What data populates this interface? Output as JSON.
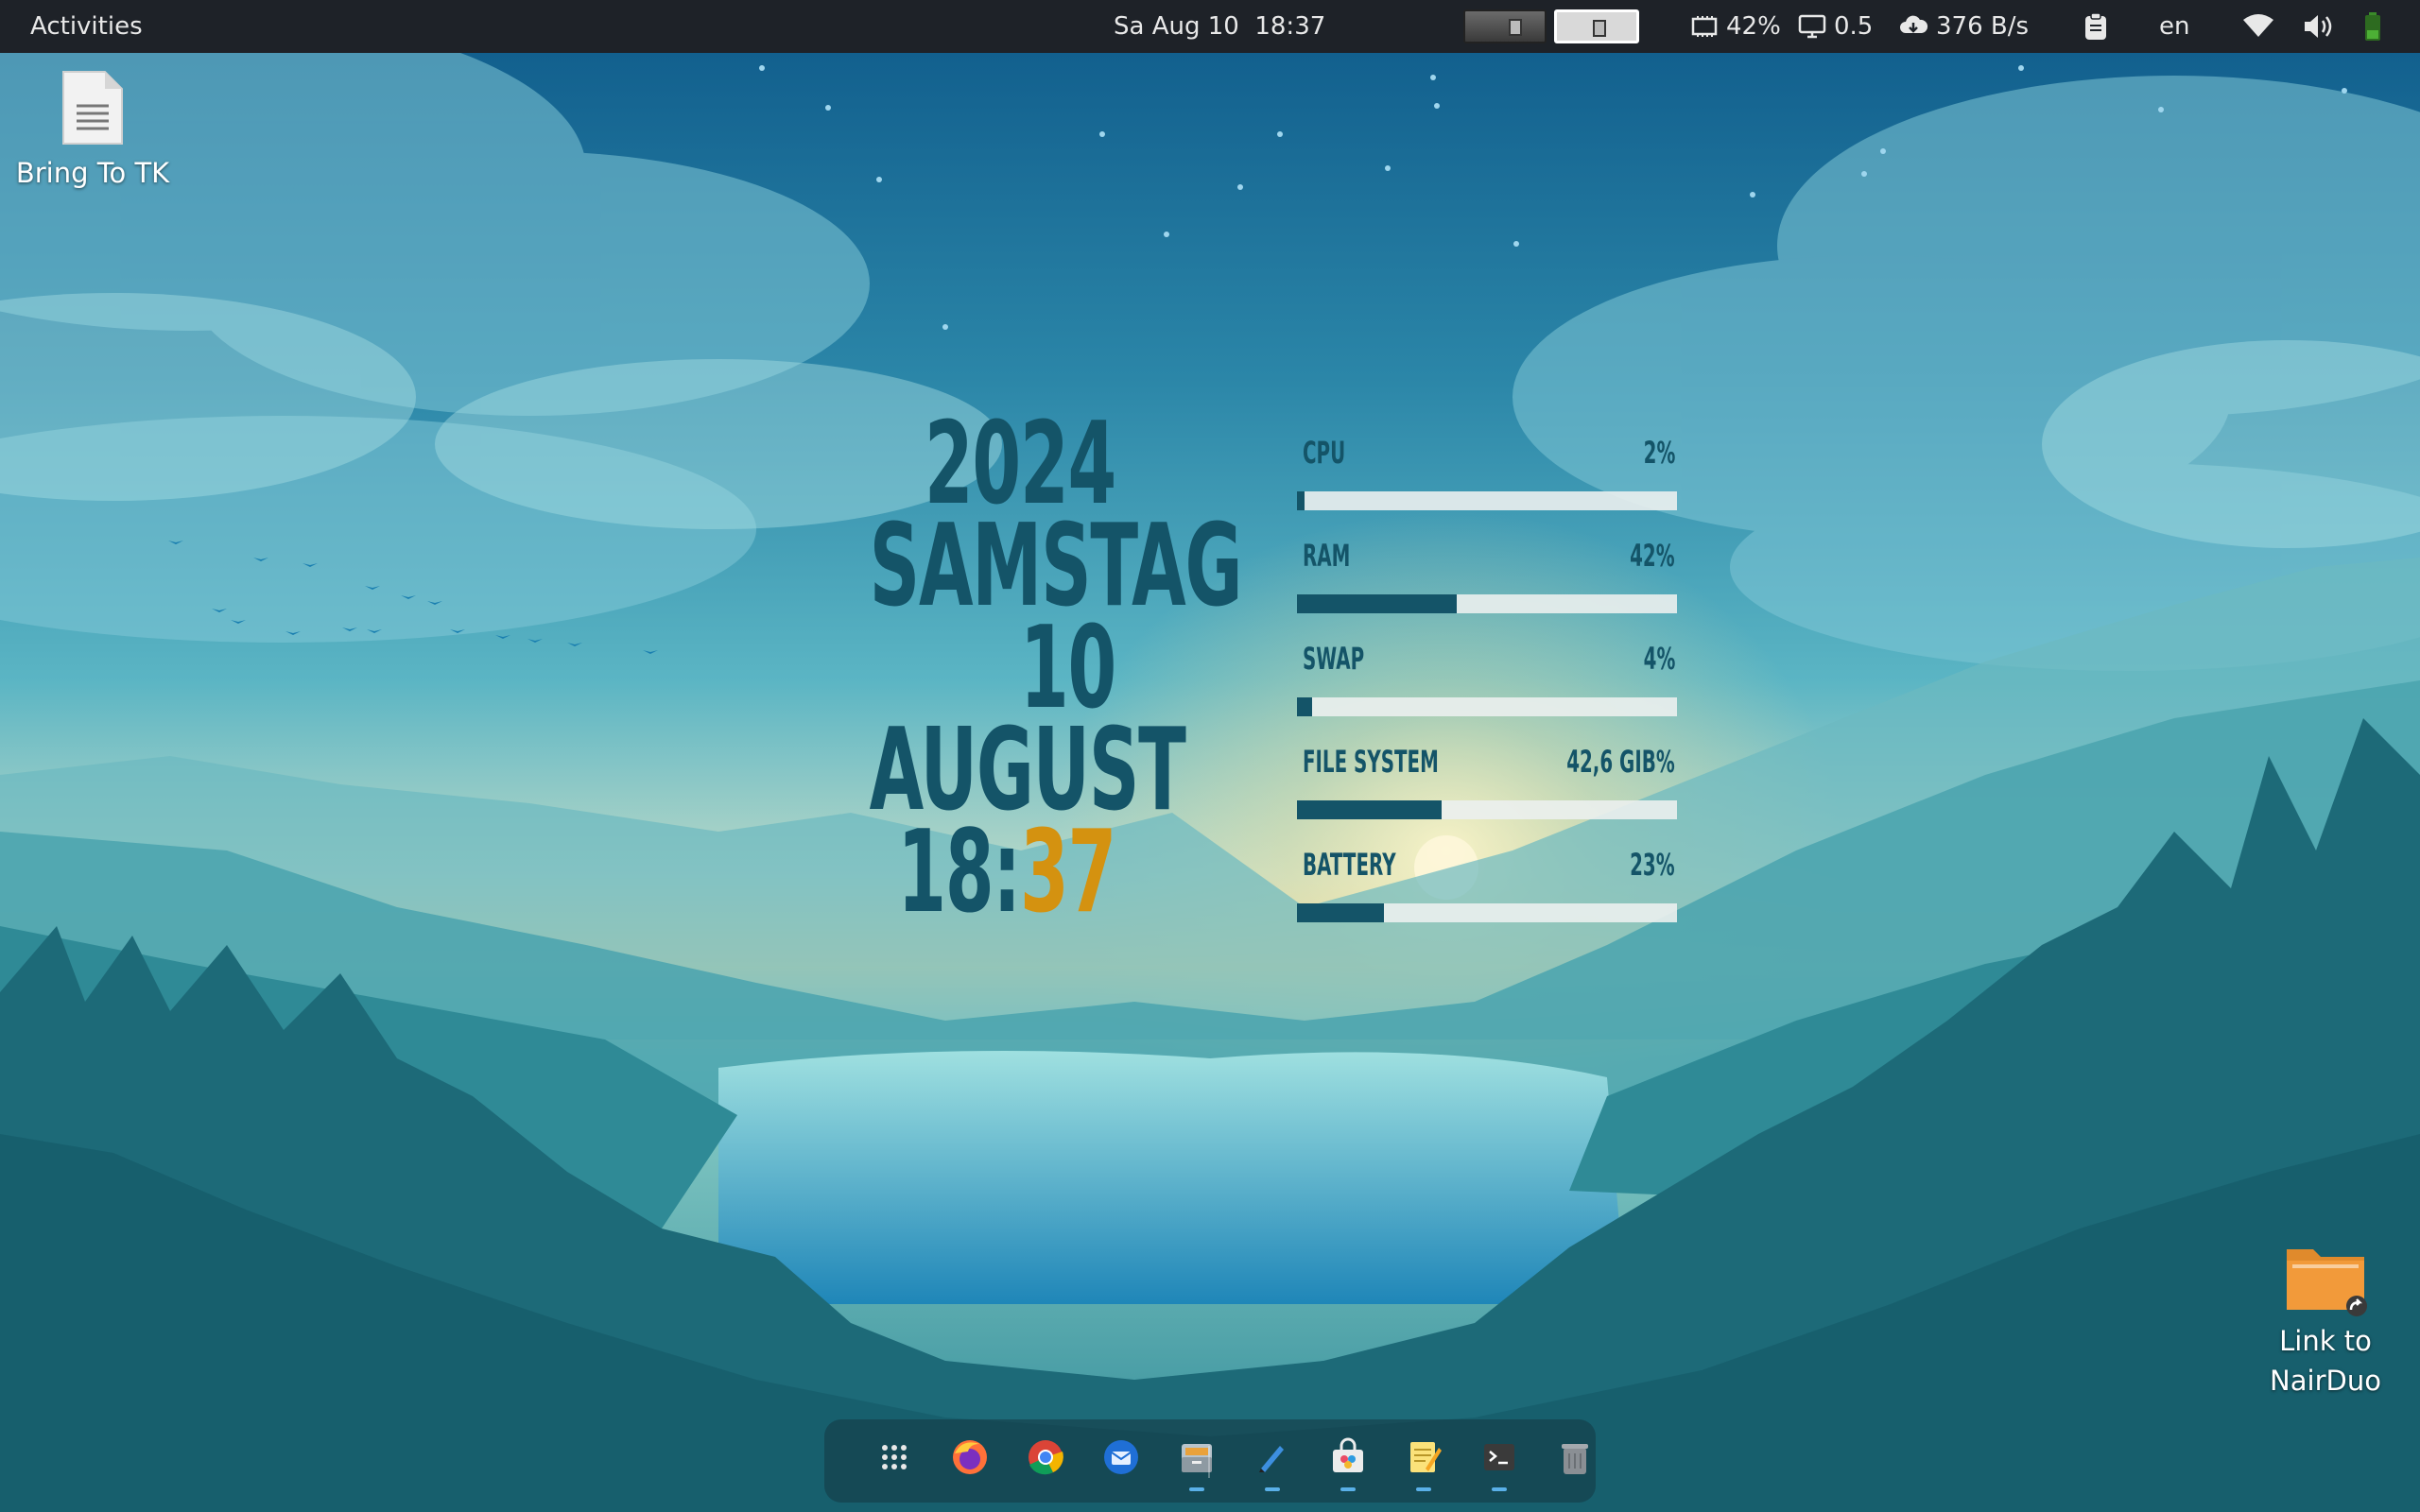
{
  "topbar": {
    "activities": "Activities",
    "clock": "Sa Aug 10  18:37",
    "workspaces": [
      "workspace-1",
      "workspace-2"
    ],
    "memory": "42%",
    "load": "0.5",
    "network": "376 B/s",
    "language": "en"
  },
  "desktop": {
    "icons": [
      {
        "label": "Bring To TK",
        "icon": "text-document-icon"
      },
      {
        "label": "Link to\nNairDuo",
        "icon": "folder-link-icon"
      }
    ]
  },
  "datewidget": {
    "year": "2024",
    "weekday": "SAMSTAG",
    "day": "10",
    "month": "AUGUST",
    "hour": "18:",
    "minute": "37"
  },
  "sysmon": {
    "items": [
      {
        "label": "CPU",
        "value": "2%",
        "fraction": 0.02
      },
      {
        "label": "RAM",
        "value": "42%",
        "fraction": 0.42
      },
      {
        "label": "SWAP",
        "value": "4%",
        "fraction": 0.04
      },
      {
        "label": "FILE SYSTEM",
        "value": "42,6 GIB%",
        "fraction": 0.38
      },
      {
        "label": "BATTERY",
        "value": "23%",
        "fraction": 0.23
      }
    ]
  },
  "dock": {
    "items": [
      {
        "name": "app-grid-icon",
        "running": false
      },
      {
        "name": "firefox-icon",
        "running": false
      },
      {
        "name": "chrome-icon",
        "running": false
      },
      {
        "name": "thunderbird-icon",
        "running": false
      },
      {
        "name": "files-icon",
        "running": true
      },
      {
        "name": "pen-editor-icon",
        "running": true
      },
      {
        "name": "software-center-icon",
        "running": true
      },
      {
        "name": "text-editor-icon",
        "running": true
      },
      {
        "name": "terminal-icon",
        "running": true
      },
      {
        "name": "trash-icon",
        "running": false
      }
    ]
  },
  "colors": {
    "topbar_bg": "#1e2228",
    "widget_text": "#145468",
    "minute_accent": "#d49210",
    "bar_track": "#ebf0ee",
    "running_dot": "#5ab0e8"
  }
}
